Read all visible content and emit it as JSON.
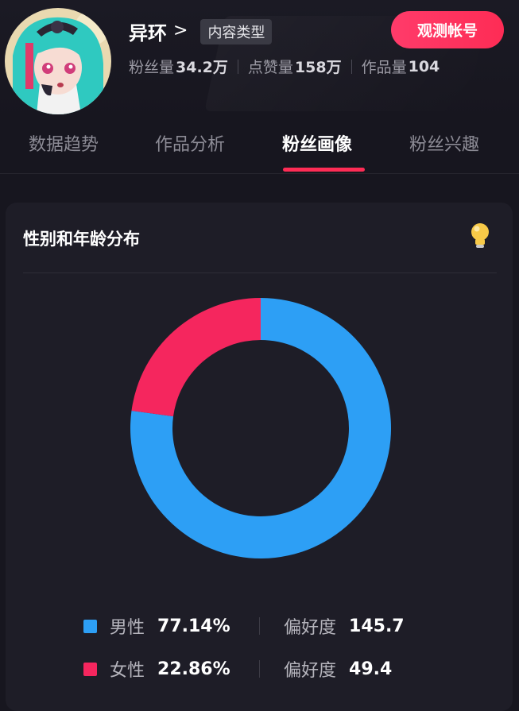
{
  "profile": {
    "name": "异环",
    "chevron": ">",
    "content_type_badge": "内容类型",
    "observe_button": "观测帐号",
    "stats": [
      {
        "label": "粉丝量",
        "value": "34.2万"
      },
      {
        "label": "点赞量",
        "value": "158万"
      },
      {
        "label": "作品量",
        "value": "104"
      }
    ]
  },
  "tabs": [
    {
      "label": "数据趋势",
      "active": false
    },
    {
      "label": "作品分析",
      "active": false
    },
    {
      "label": "粉丝画像",
      "active": true
    },
    {
      "label": "粉丝兴趣",
      "active": false
    }
  ],
  "card": {
    "title": "性别和年龄分布",
    "icon": "lightbulb-icon"
  },
  "colors": {
    "accent": "#fe2c55",
    "male": "#2d9ff5",
    "female": "#f5265e",
    "background": "#17161f"
  },
  "chart_data": {
    "type": "pie",
    "style": "donut",
    "categories": [
      "男性",
      "女性"
    ],
    "values": [
      77.14,
      22.86
    ],
    "percent_labels": [
      "77.14%",
      "22.86%"
    ],
    "preference_label": "偏好度",
    "preference_values": [
      "145.7",
      "49.4"
    ],
    "colors": [
      "#2d9ff5",
      "#f5265e"
    ]
  }
}
